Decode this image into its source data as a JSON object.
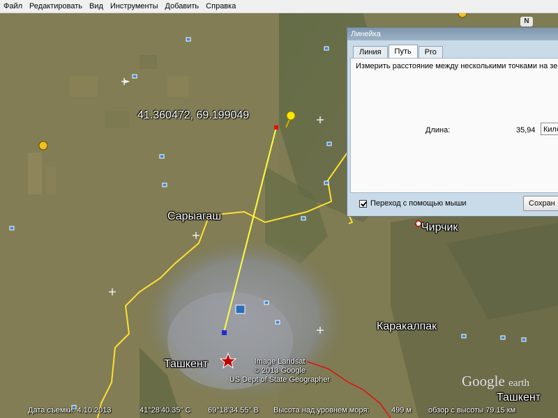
{
  "menu": [
    "Файл",
    "Редактировать",
    "Вид",
    "Инструменты",
    "Добавить",
    "Справка"
  ],
  "map": {
    "cities": [
      {
        "id": "saryagash",
        "name": "Сарыагаш"
      },
      {
        "id": "chirchik",
        "name": "Чирчик"
      },
      {
        "id": "karakalpak",
        "name": "Каракалпак"
      },
      {
        "id": "tashkent",
        "name": "Ташкент"
      },
      {
        "id": "tashkent-edge",
        "name": "Ташкент"
      }
    ],
    "coordinate_readout": "41.360472, 69.199049",
    "attribution": [
      "Image Landsat",
      "© 2013 Google",
      "US Dept of State Geographer"
    ],
    "logo_word": "Google",
    "logo_suffix": "earth",
    "nav_letter": "N",
    "colors": {
      "border": "#ffe033",
      "route": "#e01010",
      "path": "#ffff40",
      "land": "#7c7a52"
    }
  },
  "status": {
    "date": "Дата съемки: 4.10.2013",
    "lat": "41°28'40.35\" С",
    "lon": "69°18'34.55\" В",
    "elevation_label": "Высота над уровнем моря:",
    "elevation_value": "499 м",
    "eye_alt": "обзор с высоты  79.15 км"
  },
  "ruler": {
    "title": "Линейка",
    "tabs": [
      "Линия",
      "Путь",
      "Pro"
    ],
    "active_tab": "Путь",
    "description": "Измерить расстояние между несколькими точками на зем",
    "length_label": "Длина:",
    "length_value": "35,94",
    "unit": "Кило",
    "mouse_nav": "Переход с помощью мыши",
    "save_label": "Сохран"
  }
}
